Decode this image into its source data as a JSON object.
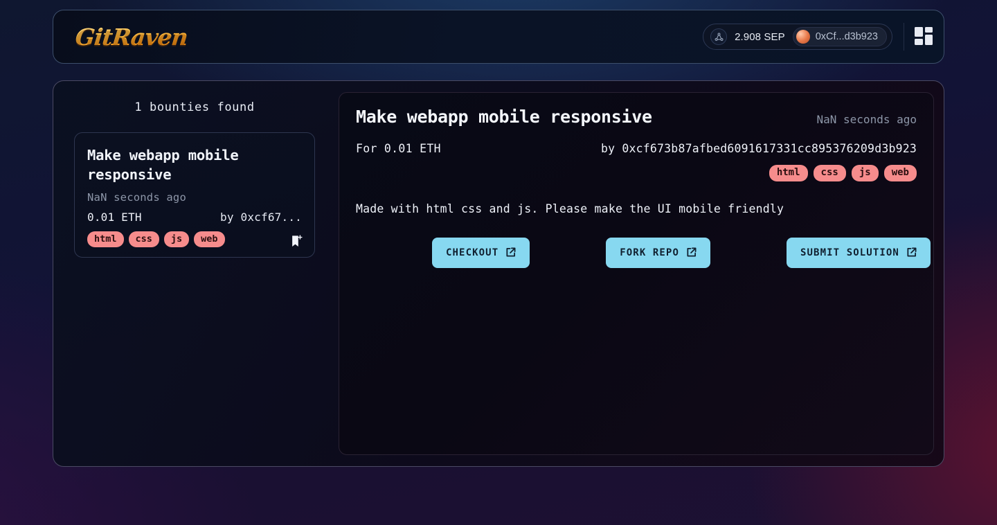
{
  "header": {
    "logo_text": "GitRaven",
    "network_icon": "network-nodes-icon",
    "balance": "2.908 SEP",
    "wallet_address_short": "0xCf...d3b923",
    "grid_icon": "dashboard-grid-icon"
  },
  "sidebar": {
    "count_label": "1 bounties found",
    "cards": [
      {
        "title": "Make webapp mobile responsive",
        "time": "NaN seconds ago",
        "price": "0.01 ETH",
        "author": "by 0xcf67...",
        "tags": [
          "html",
          "css",
          "js",
          "web"
        ],
        "bookmark_icon": "bookmark-plus-icon"
      }
    ]
  },
  "detail": {
    "title": "Make webapp mobile responsive",
    "time": "NaN seconds ago",
    "price": "For 0.01 ETH",
    "author": "by 0xcf673b87afbed6091617331cc895376209d3b923",
    "tags": [
      "html",
      "css",
      "js",
      "web"
    ],
    "description": "Made with html css and js. Please make the UI mobile friendly",
    "actions": [
      {
        "label": "CHECKOUT",
        "icon": "external-link-icon"
      },
      {
        "label": "FORK REPO",
        "icon": "external-link-icon"
      },
      {
        "label": "SUBMIT SOLUTION",
        "icon": "external-link-icon"
      }
    ]
  },
  "colors": {
    "accent_button": "#87d8f0",
    "tag": "#f68c8c",
    "logo_gold": "#fcc24a",
    "background_navy": "#12152b"
  }
}
